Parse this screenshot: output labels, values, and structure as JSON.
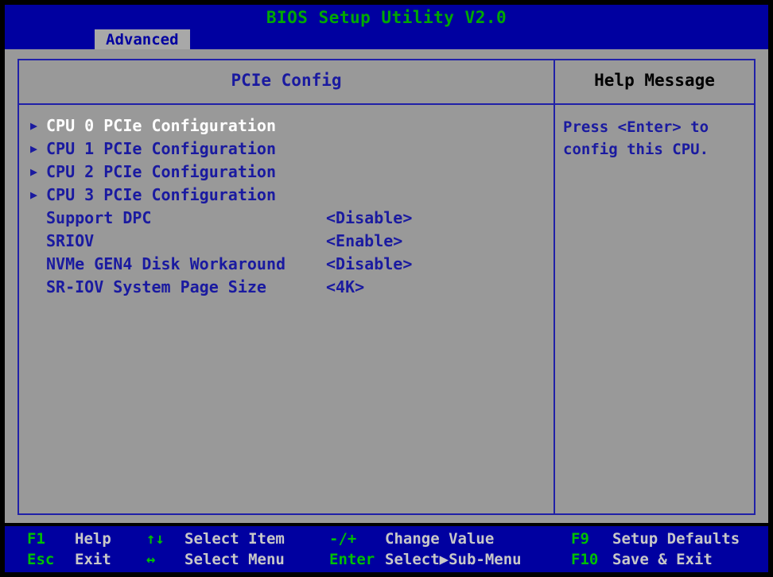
{
  "titlebar": {
    "title": "BIOS Setup Utility V2.0",
    "tabs": [
      {
        "label": "Advanced",
        "active": true
      }
    ]
  },
  "panels": {
    "main_title": "PCIe Config",
    "help_title": "Help Message"
  },
  "options": [
    {
      "arrow": "▶",
      "label": "CPU 0 PCIe Configuration",
      "value": "",
      "selected": true,
      "submenu": true
    },
    {
      "arrow": "▶",
      "label": "CPU 1 PCIe Configuration",
      "value": "",
      "selected": false,
      "submenu": true
    },
    {
      "arrow": "▶",
      "label": "CPU 2 PCIe Configuration",
      "value": "",
      "selected": false,
      "submenu": true
    },
    {
      "arrow": "▶",
      "label": "CPU 3 PCIe Configuration",
      "value": "",
      "selected": false,
      "submenu": true
    },
    {
      "arrow": "",
      "label": "Support DPC",
      "value": "<Disable>",
      "selected": false,
      "submenu": false
    },
    {
      "arrow": "",
      "label": "SRIOV",
      "value": "<Enable>",
      "selected": false,
      "submenu": false
    },
    {
      "arrow": "",
      "label": "NVMe GEN4 Disk Workaround",
      "value": "<Disable>",
      "selected": false,
      "submenu": false
    },
    {
      "arrow": "",
      "label": "SR-IOV System Page Size",
      "value": "<4K>",
      "selected": false,
      "submenu": false
    }
  ],
  "help": {
    "lines": [
      "Press <Enter> to",
      "config this CPU."
    ]
  },
  "footer": {
    "items": [
      {
        "key": "F1",
        "desc": "Help",
        "col": 0,
        "row": 0
      },
      {
        "key": "Esc",
        "desc": "Exit",
        "col": 0,
        "row": 1
      },
      {
        "key": "↑↓",
        "desc": "Select Item",
        "col": 1,
        "row": 0
      },
      {
        "key": "↔",
        "desc": "Select Menu",
        "col": 1,
        "row": 1
      },
      {
        "key": "-/+",
        "desc": "Change Value",
        "col": 2,
        "row": 0
      },
      {
        "key": "Enter",
        "desc": "Select▶Sub-Menu",
        "col": 2,
        "row": 1
      },
      {
        "key": "F9",
        "desc": "Setup Defaults",
        "col": 3,
        "row": 0
      },
      {
        "key": "F10",
        "desc": "Save & Exit",
        "col": 3,
        "row": 1
      }
    ]
  },
  "colors": {
    "screen_black": "#000000",
    "bios_blue": "#0000a0",
    "body_gray": "#999999",
    "tab_gray": "#a8a8a8",
    "title_green": "#00a800",
    "text_blue": "#1a1aa0",
    "selected_white": "#ffffff",
    "footer_key_green": "#00c000",
    "footer_desc_gray": "#c8c8c8",
    "border_blue": "#2020a8"
  }
}
